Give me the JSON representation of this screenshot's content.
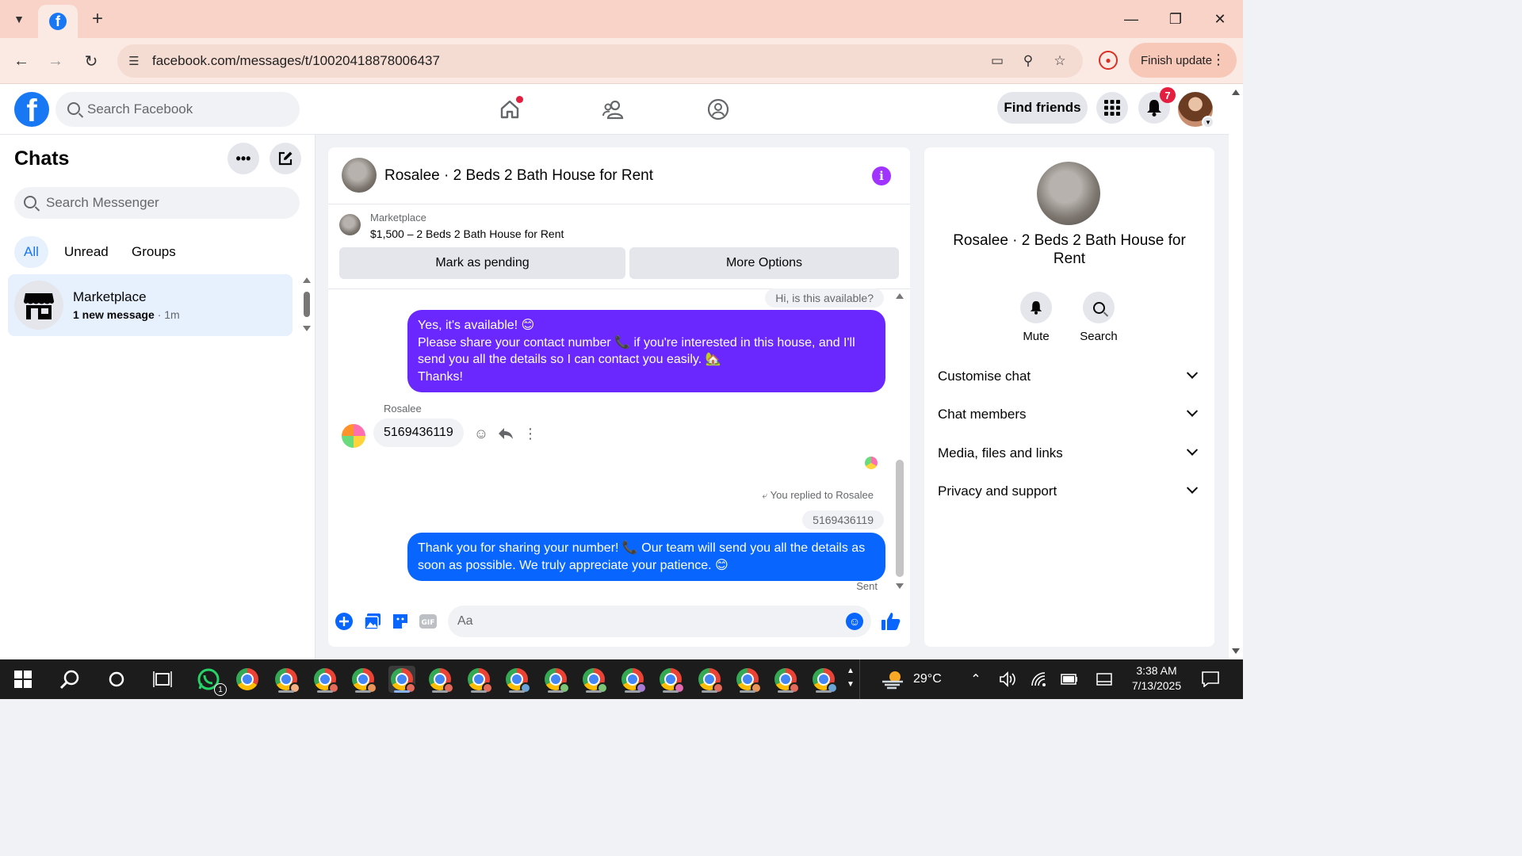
{
  "browser": {
    "url": "facebook.com/messages/t/10020418878006437",
    "finish_update_label": "Finish update"
  },
  "fb_header": {
    "search_placeholder": "Search Facebook",
    "find_friends_label": "Find friends",
    "notification_count": "7"
  },
  "chats": {
    "title": "Chats",
    "search_placeholder": "Search Messenger",
    "filters": [
      "All",
      "Unread",
      "Groups"
    ],
    "items": [
      {
        "name": "Marketplace",
        "preview": "1 new message",
        "time": "1m"
      }
    ]
  },
  "conversation": {
    "title": "Rosalee · 2 Beds 2 Bath House for Rent",
    "marketplace_label": "Marketplace",
    "listing": "$1,500 – 2 Beds 2 Bath House for Rent",
    "mark_pending_label": "Mark as pending",
    "more_options_label": "More Options",
    "messages": {
      "quoted_question": "Hi, is this available?",
      "reply_1_lines": [
        "Yes, it's available! 😊",
        "Please share your contact number 📞 if you're interested in this house, and I'll send you all the details so I can contact you easily. 🏡",
        "Thanks!"
      ],
      "sender_name": "Rosalee",
      "incoming_number": "5169436119",
      "replied_to": "You replied to Rosalee",
      "quoted_number": "5169436119",
      "reply_2": "Thank you for sharing your number! 📞 Our team will send you all the details as soon as possible. We truly appreciate your patience. 😊",
      "status": "Sent"
    },
    "composer_placeholder": "Aa",
    "colors": {
      "purple_bubble": "#6a28ff",
      "blue_bubble": "#0866ff",
      "accent": "#1877f2"
    }
  },
  "info_panel": {
    "name": "Rosalee · 2 Beds 2 Bath House for Rent",
    "actions": [
      "Mute",
      "Search"
    ],
    "sections": [
      "Customise chat",
      "Chat members",
      "Media, files and links",
      "Privacy and support"
    ]
  },
  "taskbar": {
    "weather": "29°C",
    "time": "3:38 AM",
    "date": "7/13/2025",
    "whatsapp_badge": "1"
  }
}
